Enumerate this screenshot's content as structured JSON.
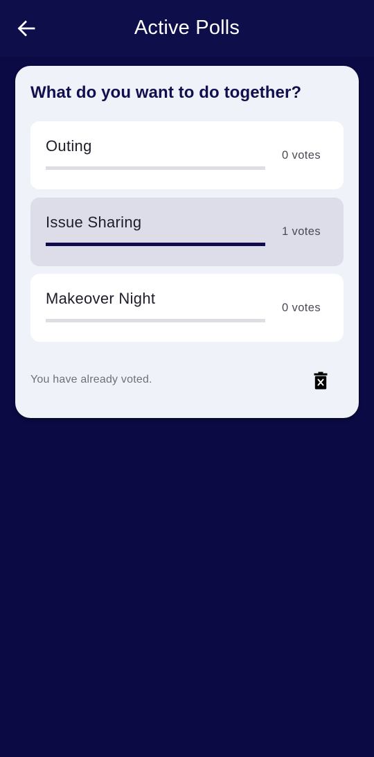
{
  "appbar": {
    "title": "Active Polls",
    "back_icon": "arrow-left-icon"
  },
  "poll": {
    "question": "What do you want to do together?",
    "options": [
      {
        "label": "Outing",
        "votes_text": "0 votes",
        "fraction": 0,
        "selected": false
      },
      {
        "label": "Issue Sharing",
        "votes_text": "1 votes",
        "fraction": 1,
        "selected": true
      },
      {
        "label": "Makeover Night",
        "votes_text": "0 votes",
        "fraction": 0,
        "selected": false
      }
    ],
    "status_text": "You have already voted.",
    "delete_icon": "trash-x-icon"
  },
  "colors": {
    "background": "#0b0a45",
    "appbar": "#0e0e4a",
    "card": "#eff2f9",
    "selected_option": "#dcdde8",
    "bar_fill": "#0e0c4c",
    "bar_track": "#dedee2"
  }
}
